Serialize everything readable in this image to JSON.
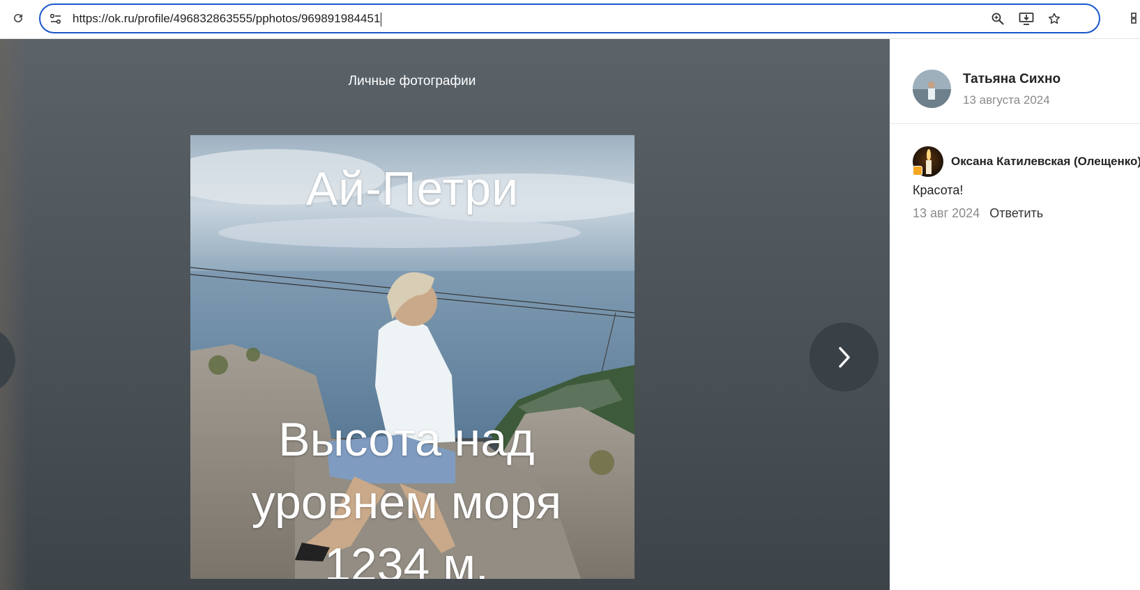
{
  "browser": {
    "url": "https://ok.ru/profile/496832863555/pphotos/969891984451",
    "icons": [
      "reload-icon",
      "site-settings-icon",
      "zoom-icon",
      "install-app-icon",
      "bookmark-star-icon",
      "extensions-icon"
    ]
  },
  "viewer": {
    "album_title": "Личные фотографии",
    "photo": {
      "caption_top": "Ай-Петри",
      "caption_bottom_line1": "Высота над",
      "caption_bottom_line2": "уровнем моря",
      "caption_bottom_line3": "1234 м."
    },
    "next_icon": "chevron-right-icon"
  },
  "panel": {
    "author": {
      "name": "Татьяна Сихно",
      "date": "13 августа 2024"
    },
    "comments": [
      {
        "author": "Оксана Катилевская (Олещенко)",
        "text": "Красота!",
        "date": "13 авг 2024",
        "reply_label": "Ответить"
      }
    ]
  },
  "colors": {
    "omnibox_border": "#1a57c9",
    "viewer_bg": "#4d555b",
    "nav_button": "#3a4146"
  }
}
